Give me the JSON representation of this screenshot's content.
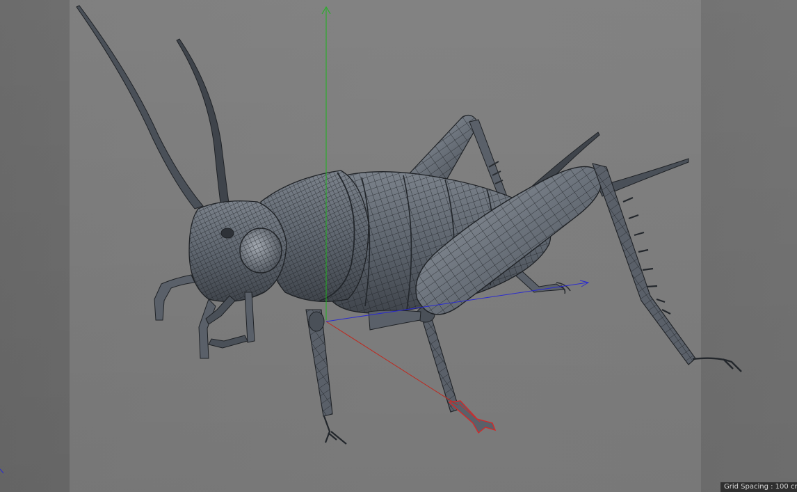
{
  "viewport": {
    "grid_spacing_label": "Grid Spacing : 100 cm"
  },
  "scene": {
    "model": "cricket-wireframe-mesh",
    "axes": {
      "y_color": "#1db31d",
      "x_color": "#c0271d",
      "z_color": "#2a2acf"
    },
    "mesh_colors": {
      "shade": "#5a6069",
      "shade_light": "#8c929a",
      "shade_dark": "#3f444b",
      "wire": "#1f2226",
      "selection": "#d22a2a"
    }
  }
}
